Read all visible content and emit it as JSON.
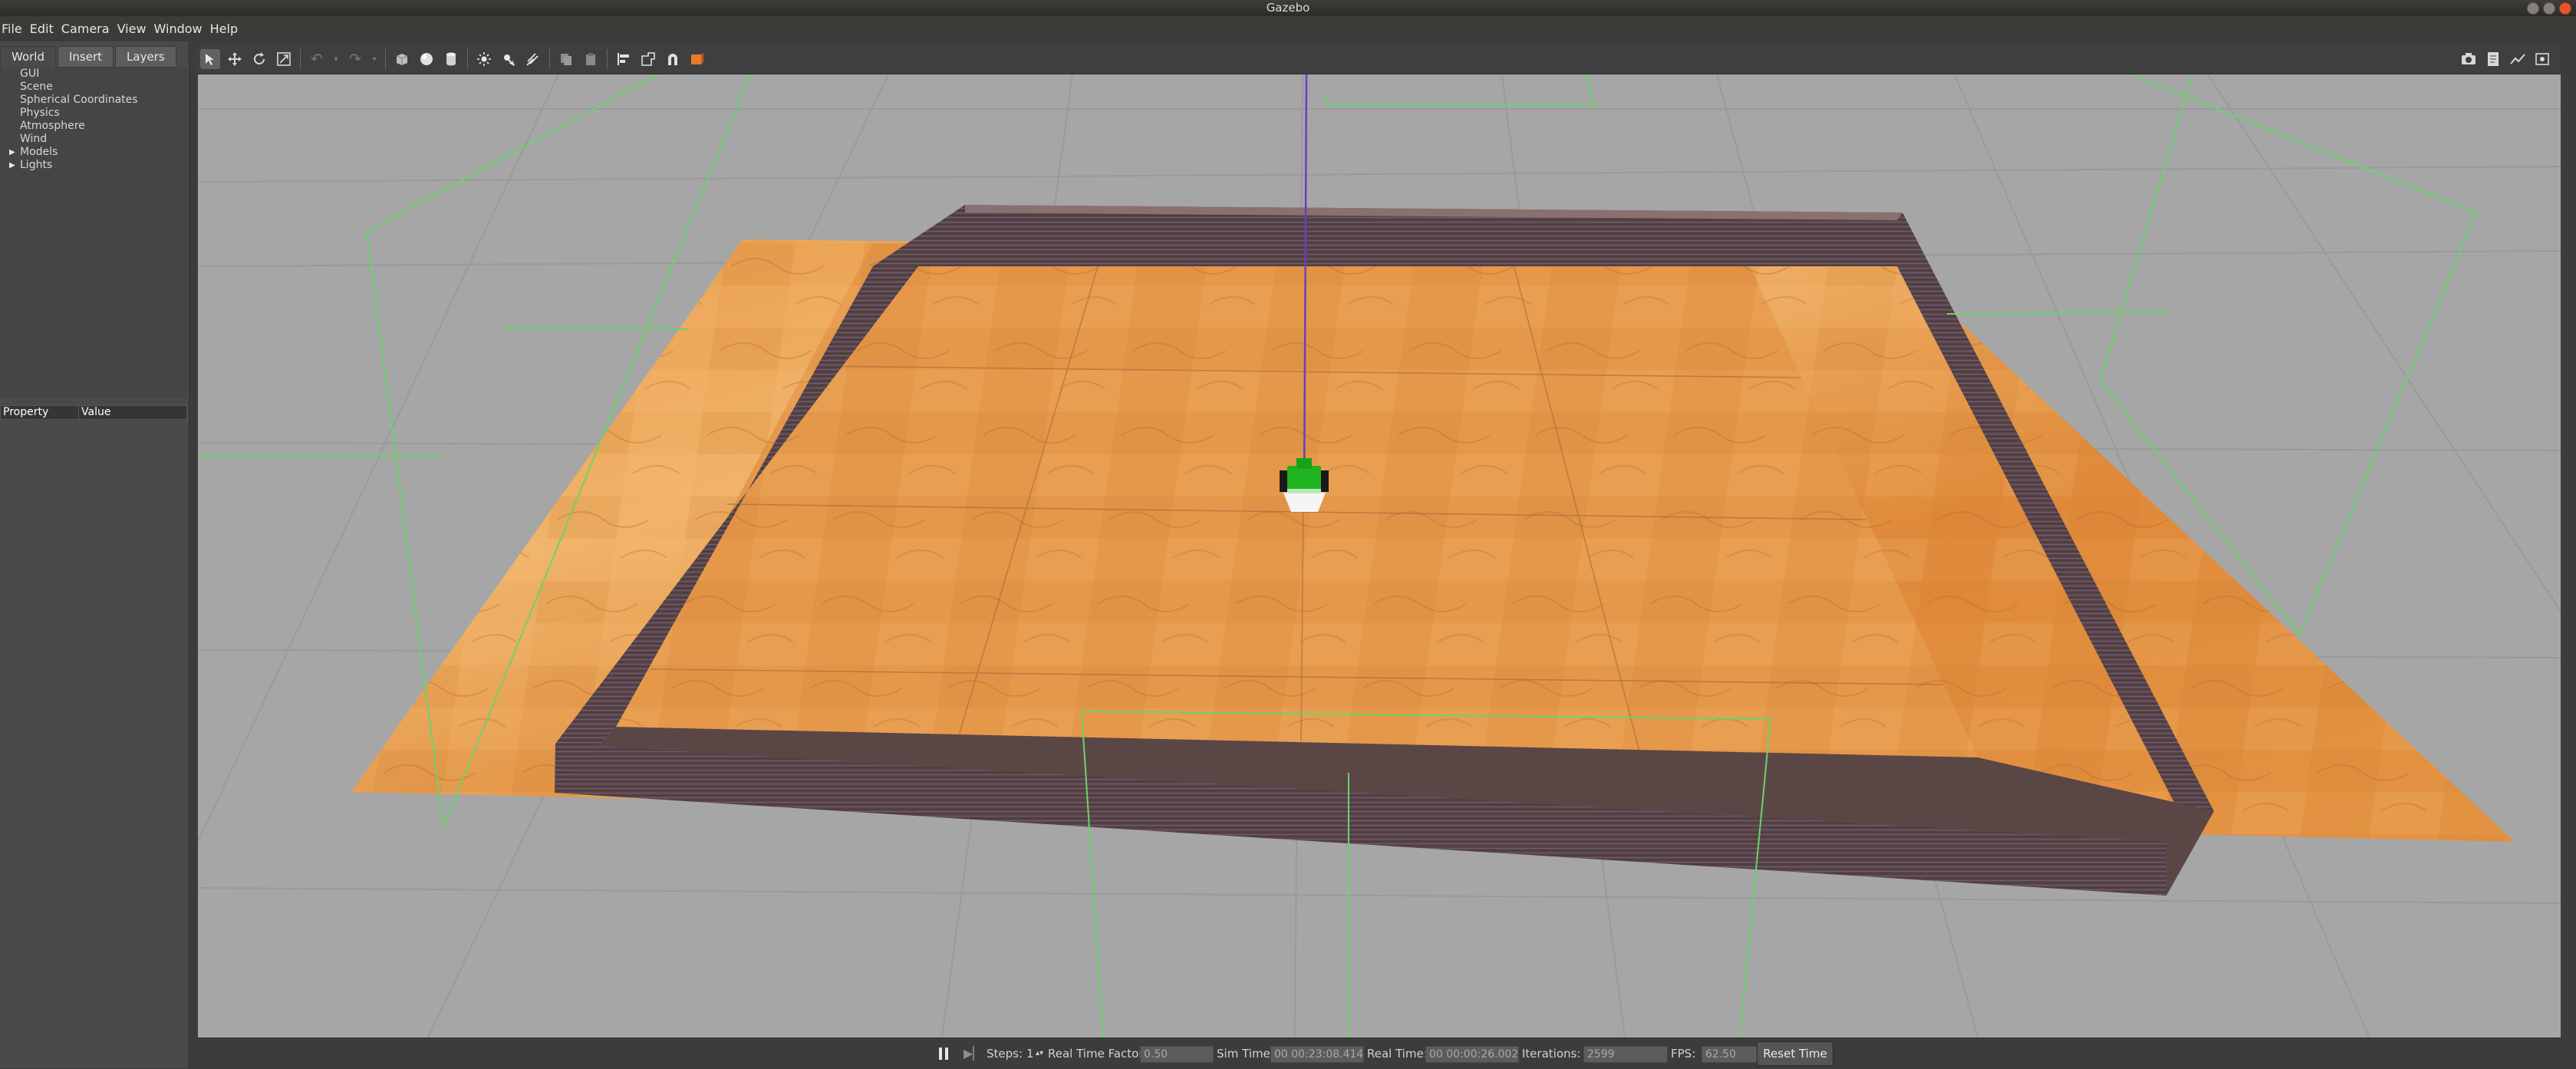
{
  "window": {
    "title": "Gazebo"
  },
  "menu": [
    "File",
    "Edit",
    "Camera",
    "View",
    "Window",
    "Help"
  ],
  "tabs": [
    "World",
    "Insert",
    "Layers"
  ],
  "tree": [
    {
      "label": "GUI",
      "expandable": false
    },
    {
      "label": "Scene",
      "expandable": false
    },
    {
      "label": "Spherical Coordinates",
      "expandable": false
    },
    {
      "label": "Physics",
      "expandable": false
    },
    {
      "label": "Atmosphere",
      "expandable": false
    },
    {
      "label": "Wind",
      "expandable": false
    },
    {
      "label": "Models",
      "expandable": true
    },
    {
      "label": "Lights",
      "expandable": true
    }
  ],
  "property_table": {
    "col_property": "Property",
    "col_value": "Value"
  },
  "toolbar_icons": [
    "select-arrow-icon",
    "translate-icon",
    "rotate-icon",
    "scale-icon",
    "undo-icon",
    "undo-dropdown-icon",
    "redo-icon",
    "redo-dropdown-icon",
    "box-icon",
    "sphere-icon",
    "cylinder-icon",
    "point-light-icon",
    "spot-light-icon",
    "directional-light-icon",
    "copy-icon",
    "paste-icon",
    "align-icon",
    "snap-icon",
    "magnet-icon",
    "view-angle-icon"
  ],
  "toolbar_right_icons": [
    "screenshot-icon",
    "log-icon",
    "plot-icon",
    "video-record-icon"
  ],
  "bottom": {
    "steps_label": "Steps:",
    "steps_value": "1",
    "rtf_label": "Real Time Factor:",
    "rtf_value": "0.50",
    "sim_label": "Sim Time:",
    "sim_value": "00 00:23:08.414",
    "real_label": "Real Time:",
    "real_value": "00 00:00:26.002",
    "iter_label": "Iterations:",
    "iter_value": "2599",
    "fps_label": "FPS:",
    "fps_value": "62.50",
    "reset_label": "Reset Time"
  },
  "colors": {
    "ground": "#a6a6a6",
    "floor": "#e0903f",
    "wall": "#5a4242",
    "robot": "#22b322",
    "camera_frustum": "#6bd36b"
  }
}
